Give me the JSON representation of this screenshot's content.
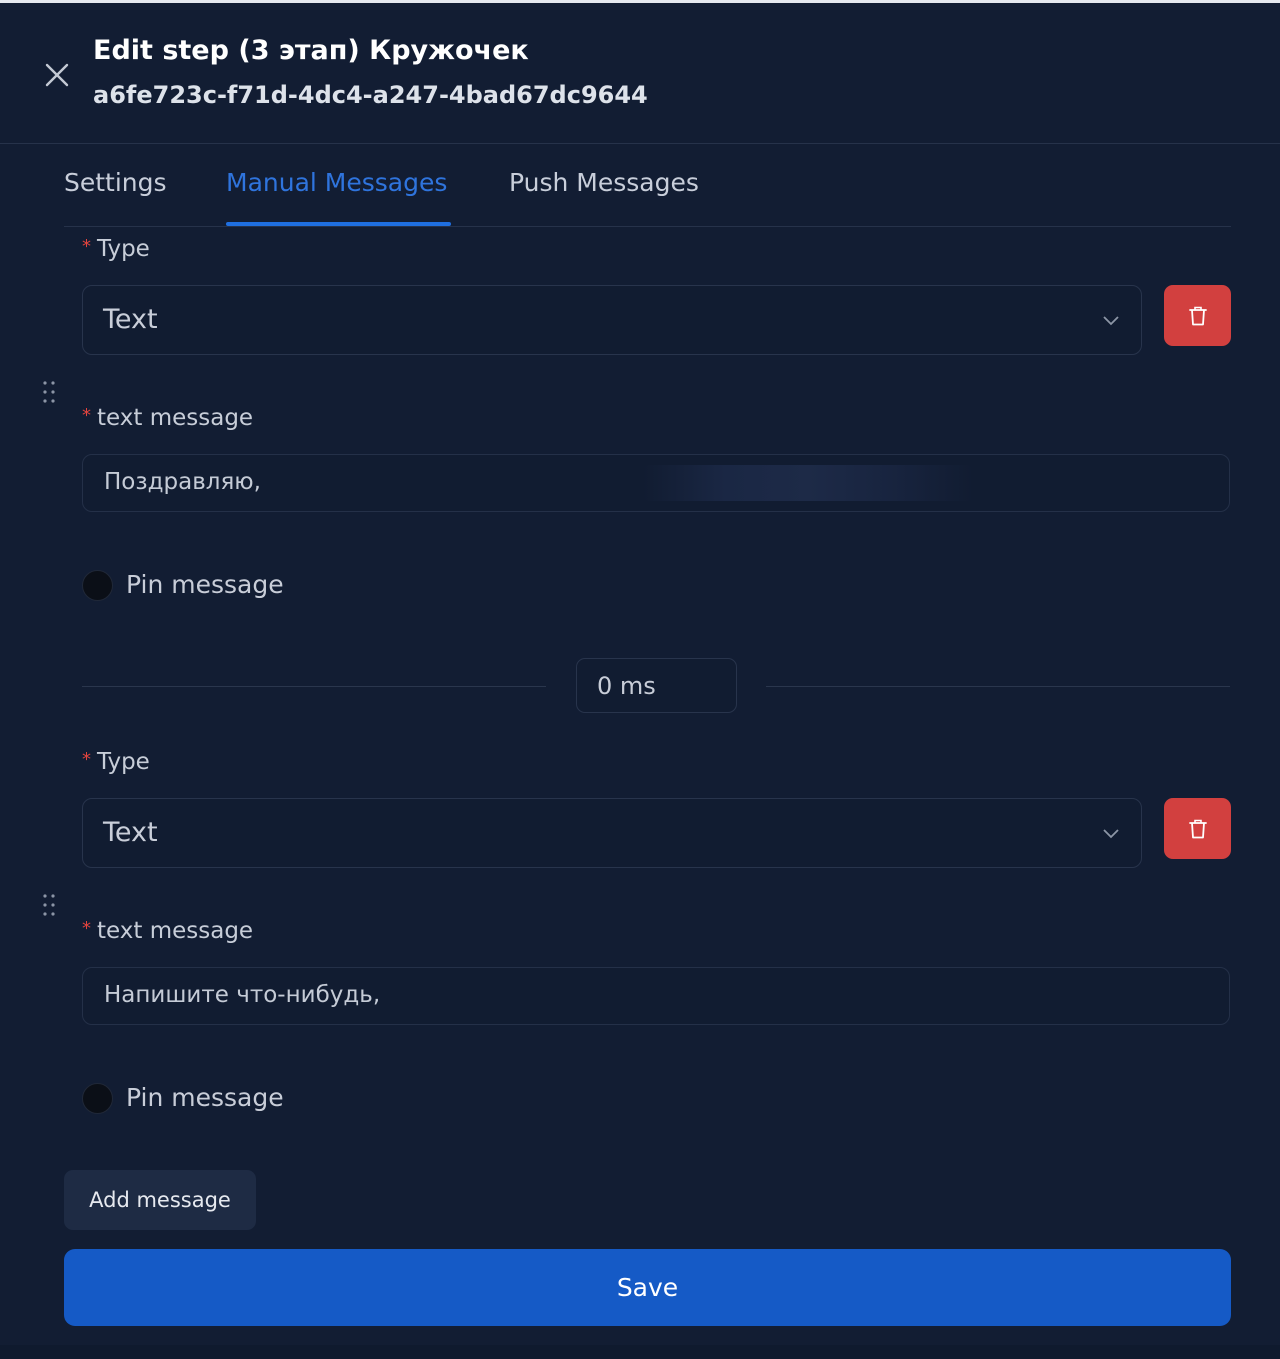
{
  "header": {
    "title": "Edit step (3 этап) Кружочек",
    "id": "a6fe723c-f71d-4dc4-a247-4bad67dc9644"
  },
  "tabs": [
    {
      "label": "Settings",
      "active": false
    },
    {
      "label": "Manual Messages",
      "active": true
    },
    {
      "label": "Push Messages",
      "active": false
    }
  ],
  "messages": [
    {
      "type_label": "Type",
      "type_value": "Text",
      "text_label": "text message",
      "text_value": "Поздравляю,",
      "pin_label": "Pin message",
      "pinned": false
    },
    {
      "type_label": "Type",
      "type_value": "Text",
      "text_label": "text message",
      "text_value": "Напишите что-нибудь,",
      "pin_label": "Pin message",
      "pinned": false
    }
  ],
  "delay": {
    "value": "0 ms"
  },
  "actions": {
    "add_message": "Add message",
    "save": "Save"
  },
  "colors": {
    "background": "#121d33",
    "accent": "#155ac6",
    "active_tab": "#2f74dd",
    "danger": "#d2403f",
    "required": "#e4443e"
  },
  "icons": {
    "close": "close-icon",
    "chevron": "chevron-down-icon",
    "delete": "trash-icon",
    "drag": "drag-handle-icon"
  }
}
